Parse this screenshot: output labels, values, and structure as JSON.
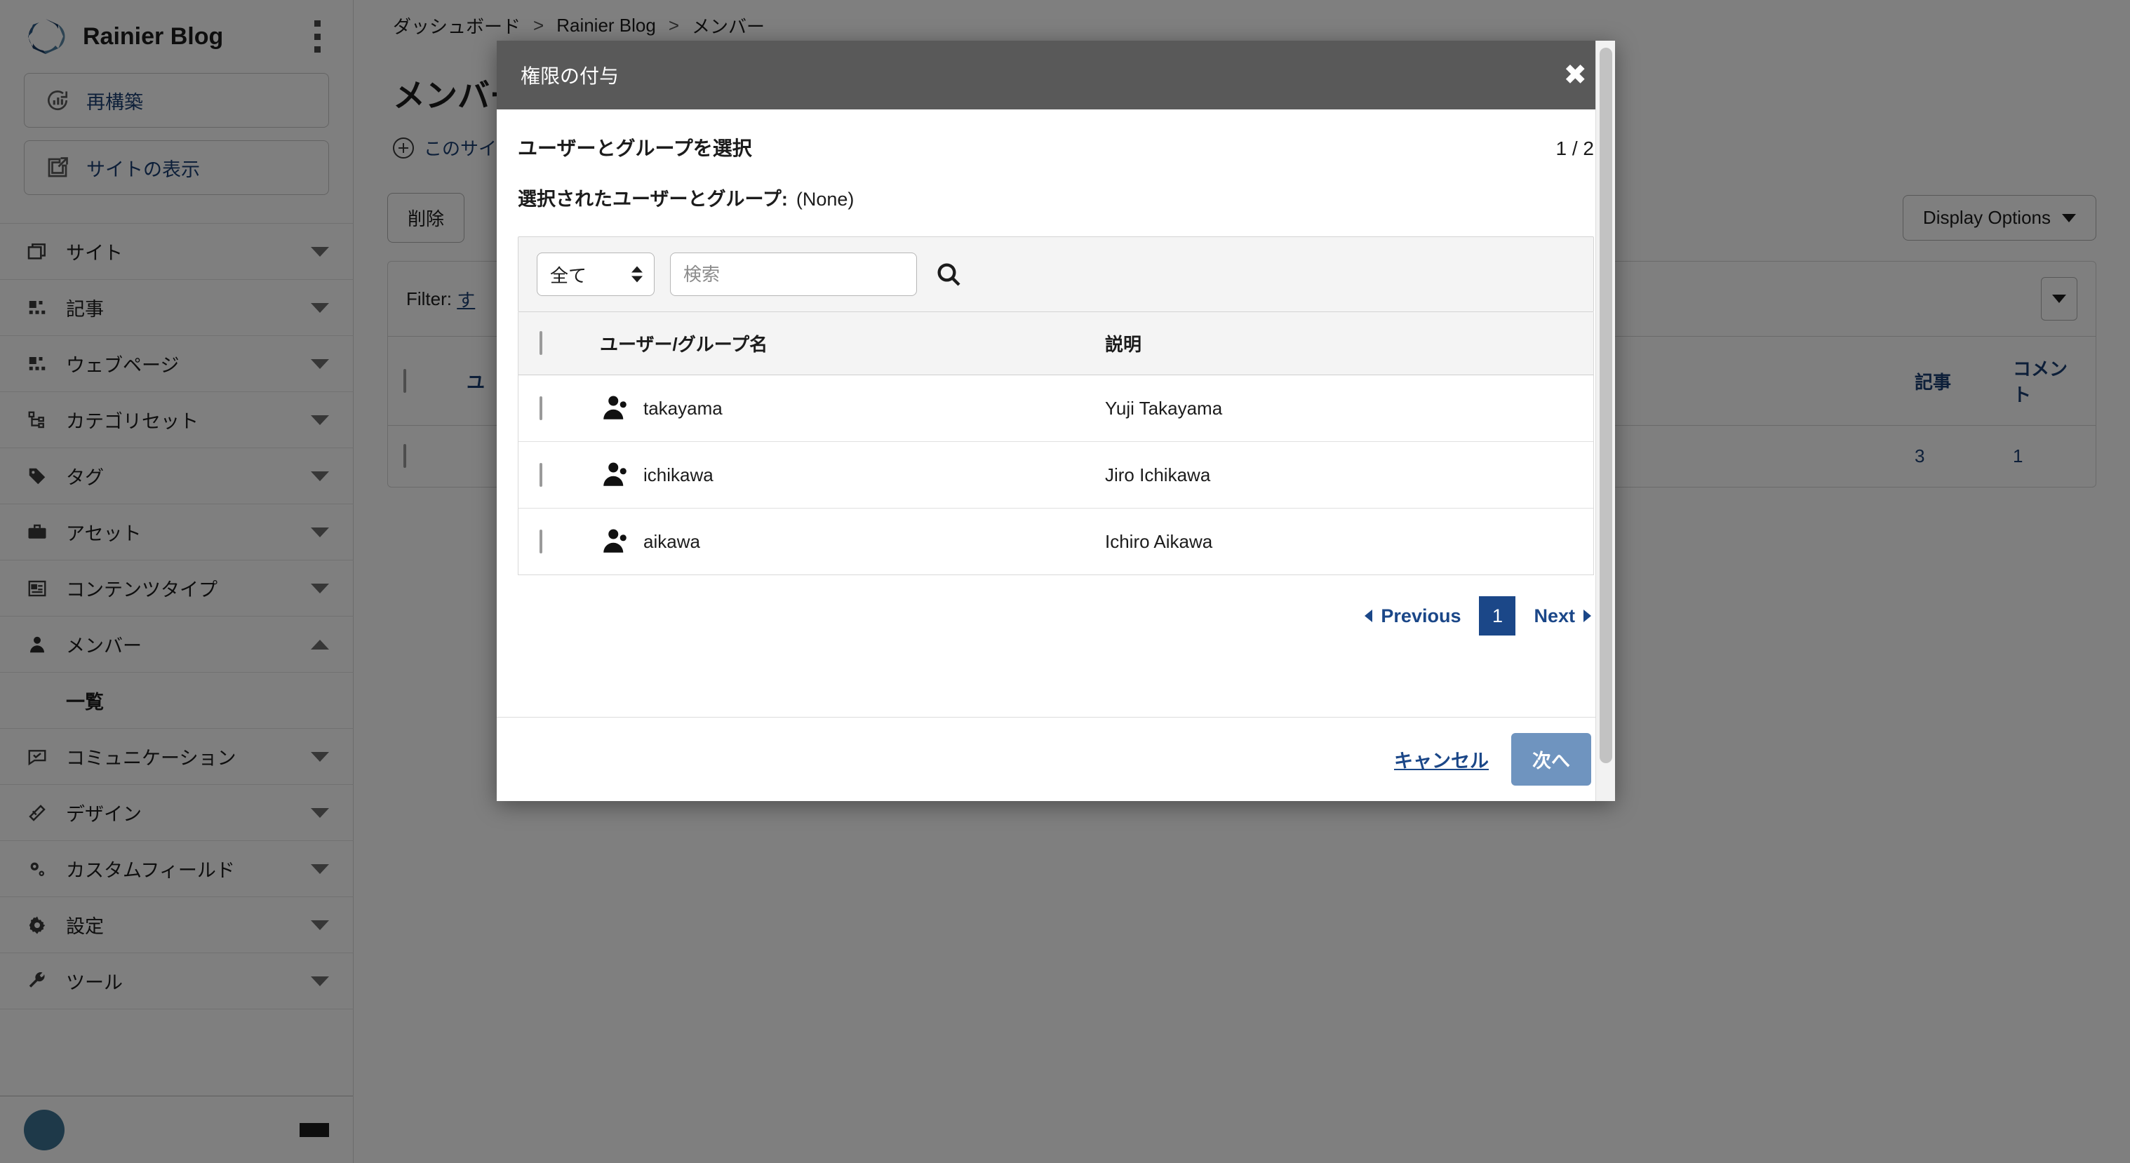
{
  "sidebar": {
    "brand": {
      "title": "Rainier Blog",
      "logo_icon": "movable-type-logo",
      "menu_icon": "kebab-menu-icon"
    },
    "buttons": [
      {
        "label": "再構築",
        "icon": "rebuild-icon"
      },
      {
        "label": "サイトの表示",
        "icon": "external-link-icon"
      }
    ],
    "items": [
      {
        "label": "サイト",
        "icon": "sites-icon",
        "expanded": false
      },
      {
        "label": "記事",
        "icon": "entries-icon",
        "expanded": false
      },
      {
        "label": "ウェブページ",
        "icon": "pages-icon",
        "expanded": false
      },
      {
        "label": "カテゴリセット",
        "icon": "category-set-icon",
        "expanded": false
      },
      {
        "label": "タグ",
        "icon": "tag-icon",
        "expanded": false
      },
      {
        "label": "アセット",
        "icon": "asset-icon",
        "expanded": false
      },
      {
        "label": "コンテンツタイプ",
        "icon": "content-type-icon",
        "expanded": false
      },
      {
        "label": "メンバー",
        "icon": "member-icon",
        "expanded": true
      },
      {
        "label": "コミュニケーション",
        "icon": "communication-icon",
        "expanded": false
      },
      {
        "label": "デザイン",
        "icon": "design-icon",
        "expanded": false
      },
      {
        "label": "カスタムフィールド",
        "icon": "custom-field-icon",
        "expanded": false
      },
      {
        "label": "設定",
        "icon": "settings-icon",
        "expanded": false
      },
      {
        "label": "ツール",
        "icon": "tools-icon",
        "expanded": false
      }
    ],
    "member_sub_label": "一覧"
  },
  "page": {
    "breadcrumb": [
      "ダッシュボード",
      "Rainier Blog",
      "メンバー"
    ],
    "breadcrumb_separator": ">",
    "title": "メンバー",
    "add_link": "このサイ",
    "delete_button": "削除",
    "display_options_button": "Display Options",
    "filter_label": "Filter:",
    "filter_value": "す",
    "table": {
      "columns": [
        "ユ",
        "記事",
        "コメント"
      ],
      "rows": [
        {
          "articles": "3",
          "comments": "1"
        }
      ]
    }
  },
  "modal": {
    "title": "権限の付与",
    "close_icon": "close-icon",
    "section_title": "ユーザーとグループを選択",
    "step_indicator": "1 / 2",
    "selected_label": "選択されたユーザーとグループ:",
    "selected_value": "(None)",
    "search": {
      "filter_value": "全て",
      "placeholder": "検索",
      "input_value": "",
      "search_icon": "search-icon"
    },
    "table": {
      "columns": [
        "ユーザー/グループ名",
        "説明"
      ],
      "rows": [
        {
          "name": "takayama",
          "description": "Yuji Takayama",
          "checked": false,
          "icon": "user-icon"
        },
        {
          "name": "ichikawa",
          "description": "Jiro Ichikawa",
          "checked": false,
          "icon": "user-icon"
        },
        {
          "name": "aikawa",
          "description": "Ichiro Aikawa",
          "checked": false,
          "icon": "user-icon"
        }
      ]
    },
    "pagination": {
      "previous": "Previous",
      "current_page": "1",
      "next": "Next"
    },
    "footer": {
      "cancel": "キャンセル",
      "next": "次へ"
    }
  },
  "colors": {
    "accent": "#1b4788",
    "link": "#1b3f73",
    "modal_header": "#595959",
    "primary_button": "#6f94bf"
  }
}
